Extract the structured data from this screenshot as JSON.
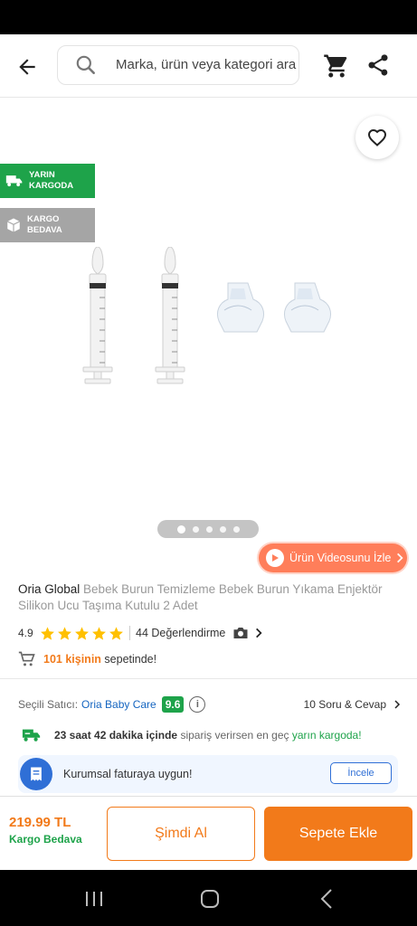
{
  "search": {
    "placeholder": "Marka, ürün veya kategori ara"
  },
  "badges": [
    {
      "label": "YARIN\nKARGODA",
      "color": "#1ea34a",
      "icon": "truck-icon"
    },
    {
      "label": "KARGO\nBEDAVA",
      "color": "#a5a5a5",
      "icon": "box-icon"
    }
  ],
  "gallery": {
    "count": 5,
    "active": 0
  },
  "video_button": {
    "label": "Ürün Videosunu İzle"
  },
  "product": {
    "brand": "Oria Global",
    "name": "Bebek Burun Temizleme Bebek Burun Yıkama Enjektör Silikon Ucu Taşıma Kutulu 2 Adet"
  },
  "rating": {
    "value": "4.9",
    "stars": 5,
    "reviews": "44 Değerlendirme"
  },
  "cart_count": {
    "count": "101 kişinin",
    "suffix": "sepetinde!"
  },
  "seller": {
    "label": "Seçili Satıcı:",
    "name": "Oria Baby Care",
    "score": "9.6"
  },
  "qa": {
    "label": "10 Soru & Cevap"
  },
  "delivery": {
    "time": "23 saat 42 dakika içinde",
    "middle": "sipariş verirsen en geç",
    "highlight": "yarın kargoda!"
  },
  "invoice": {
    "text": "Kurumsal faturaya uygun!",
    "button": "İncele"
  },
  "bottom": {
    "price": "219.99 TL",
    "shipping": "Kargo Bedava",
    "buy_now": "Şimdi Al",
    "add_to_cart": "Sepete Ekle"
  },
  "colors": {
    "accent": "#f27a1a",
    "green": "#1ea34a",
    "blue": "#2f6fd6"
  }
}
